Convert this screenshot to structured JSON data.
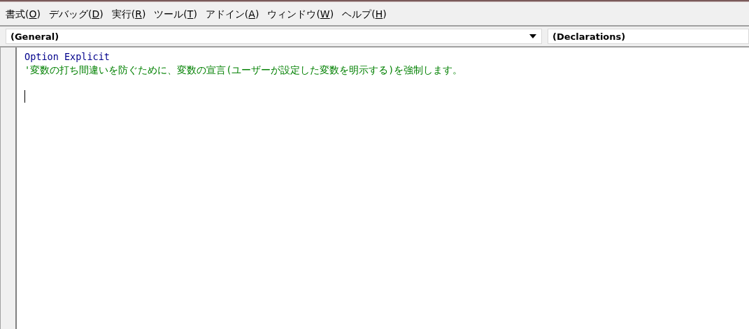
{
  "menu": [
    {
      "before": "書式(",
      "key": "O",
      "after": ")"
    },
    {
      "before": "デバッグ(",
      "key": "D",
      "after": ")"
    },
    {
      "before": "実行(",
      "key": "R",
      "after": ")"
    },
    {
      "before": "ツール(",
      "key": "T",
      "after": ")"
    },
    {
      "before": "アドイン(",
      "key": "A",
      "after": ")"
    },
    {
      "before": "ウィンドウ(",
      "key": "W",
      "after": ")"
    },
    {
      "before": "ヘルプ(",
      "key": "H",
      "after": ")"
    }
  ],
  "object_box": {
    "value": "(General)"
  },
  "procedure_box": {
    "value": "(Declarations)"
  },
  "code_lines": [
    {
      "kind": "keyword",
      "text": "Option Explicit"
    },
    {
      "kind": "comment",
      "text": "'変数の打ち間違いを防ぐために、変数の宣言(ユーザーが設定した変数を明示する)を強制します。"
    },
    {
      "kind": "blank"
    },
    {
      "kind": "cursor"
    }
  ]
}
